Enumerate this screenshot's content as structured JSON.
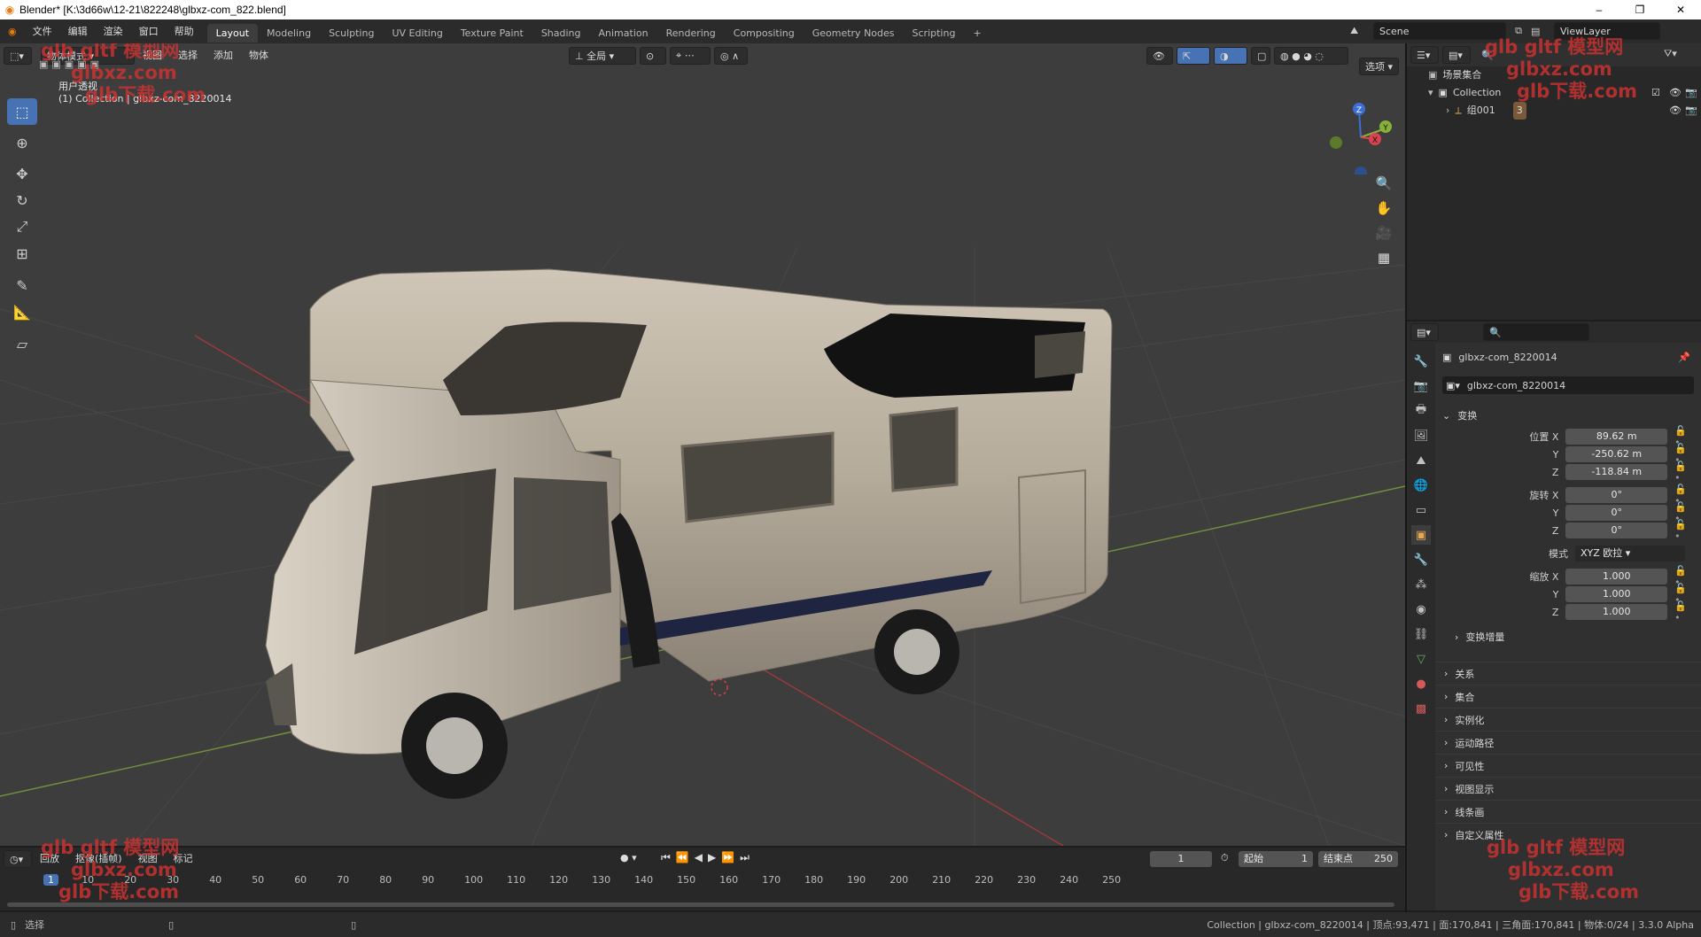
{
  "window": {
    "title": "Blender* [K:\\3d66w\\12-21\\822248\\glbxz-com_822.blend]",
    "controls": [
      "–",
      "❐",
      "✕"
    ]
  },
  "menu": [
    "文件",
    "编辑",
    "渲染",
    "窗口",
    "帮助"
  ],
  "workspaces": [
    "Layout",
    "Modeling",
    "Sculpting",
    "UV Editing",
    "Texture Paint",
    "Shading",
    "Animation",
    "Rendering",
    "Compositing",
    "Geometry Nodes",
    "Scripting"
  ],
  "workspace_add": "+",
  "scene": {
    "scene_name": "Scene",
    "view_layer": "ViewLayer"
  },
  "viewport": {
    "mode": "物体模式",
    "menus": [
      "视图",
      "选择",
      "添加",
      "物体"
    ],
    "transform_orientation": "全局",
    "options_label": "选项",
    "overlay_title": "用户透视",
    "overlay_collection": "(1) Collection | glbxz-com_8220014",
    "gizmo_axes": {
      "x": "X",
      "y": "Y",
      "z": "Z"
    }
  },
  "outliner": {
    "root": "场景集合",
    "collection": "Collection",
    "object": "组001",
    "object_badge": "3"
  },
  "properties": {
    "object_name": "glbxz-com_8220014",
    "datablock": "glbxz-com_8220014",
    "transform_title": "变换",
    "location_label": "位置 X",
    "location": {
      "x": "89.62 m",
      "y": "-250.62 m",
      "z": "-118.84 m"
    },
    "rotation_label": "旋转 X",
    "rotation": {
      "x": "0°",
      "y": "0°",
      "z": "0°"
    },
    "mode_label": "模式",
    "rotation_mode": "XYZ 欧拉",
    "scale_label": "缩放 X",
    "scale": {
      "x": "1.000",
      "y": "1.000",
      "z": "1.000"
    },
    "axis_y": "Y",
    "axis_z": "Z",
    "delta_transform": "变换增量",
    "sections": [
      "关系",
      "集合",
      "实例化",
      "运动路径",
      "可见性",
      "视图显示",
      "线条画",
      "自定义属性"
    ]
  },
  "timeline": {
    "menus": [
      "回放",
      "抠像(插帧)",
      "视图",
      "标记"
    ],
    "current_frame": "1",
    "start_label": "起始",
    "start": "1",
    "end_label": "结束点",
    "end": "250",
    "ticks": [
      "1",
      "10",
      "20",
      "30",
      "40",
      "50",
      "60",
      "70",
      "80",
      "90",
      "100",
      "110",
      "120",
      "130",
      "140",
      "150",
      "160",
      "170",
      "180",
      "190",
      "200",
      "210",
      "220",
      "230",
      "240",
      "250"
    ]
  },
  "status": {
    "left": "选择",
    "right": "Collection | glbxz-com_8220014 | 顶点:93,471 | 面:170,841 | 三角面:170,841 | 物体:0/24 | 3.3.0 Alpha"
  },
  "watermarks": [
    "glb gltf 模型网",
    "glbxz.com",
    "glb下载.com"
  ],
  "colors": {
    "accent": "#4772b3",
    "viewport_bg": "#3d3d3d",
    "panel_bg": "#303030"
  }
}
